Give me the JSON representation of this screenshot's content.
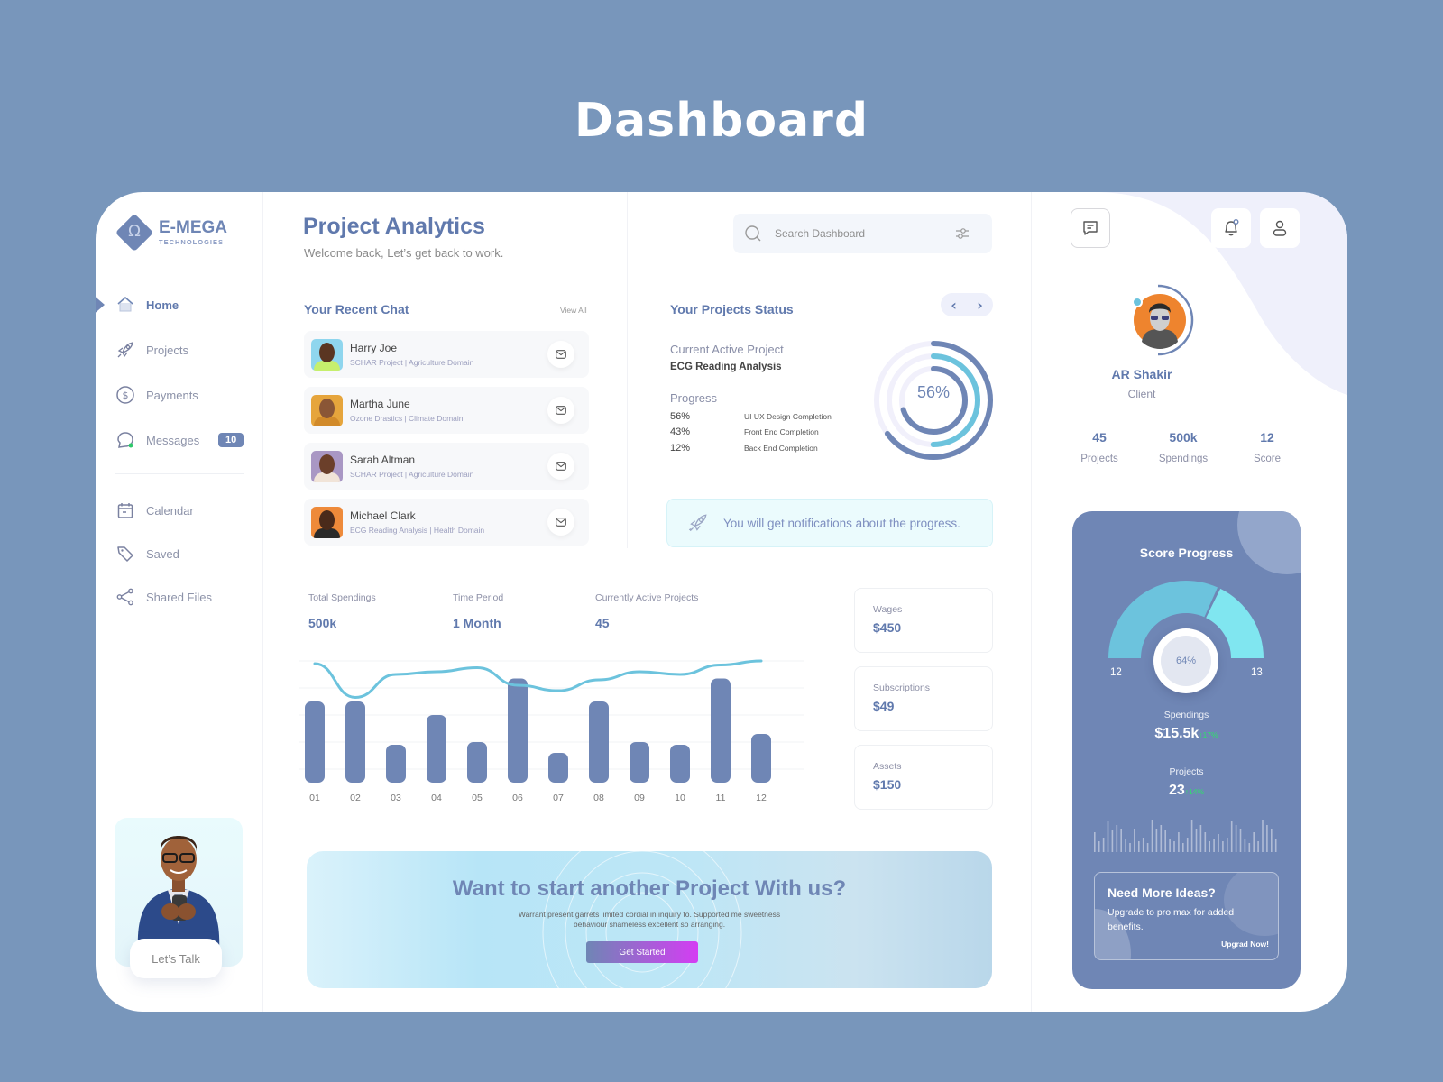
{
  "page": {
    "title": "Dashboard"
  },
  "brand": {
    "name": "E-MEGA",
    "tagline": "TECHNOLOGIES",
    "logo_icon": "omega-diamond-icon",
    "accent": "#6f86b5",
    "cyan": "#6cc3dd"
  },
  "sidebar": {
    "items": [
      {
        "label": "Home",
        "icon": "home-icon",
        "active": true
      },
      {
        "label": "Projects",
        "icon": "rocket-icon"
      },
      {
        "label": "Payments",
        "icon": "dollar-circle-icon"
      },
      {
        "label": "Messages",
        "icon": "chat-bubble-icon",
        "badge": "10"
      }
    ],
    "secondary_items": [
      {
        "label": "Calendar",
        "icon": "calendar-icon"
      },
      {
        "label": "Saved",
        "icon": "tag-icon"
      },
      {
        "label": "Shared Files",
        "icon": "share-icon"
      }
    ],
    "talk_button": "Let’s Talk"
  },
  "header": {
    "title": "Project Analytics",
    "subtitle": "Welcome back, Let’s get back to work.",
    "search_placeholder": "Search Dashboard"
  },
  "recent_chat": {
    "title": "Your Recent Chat",
    "view_all": "View All",
    "items": [
      {
        "name": "Harry Joe",
        "sub": "SCHAR Project | Agriculture Domain"
      },
      {
        "name": "Martha June",
        "sub": "Ozone Drastics | Climate Domain"
      },
      {
        "name": "Sarah Altman",
        "sub": "SCHAR Project | Agriculture Domain"
      },
      {
        "name": "Michael Clark",
        "sub": "ECG Reading Analysis | Health Domain"
      }
    ]
  },
  "project_status": {
    "title": "Your Projects Status",
    "current_label": "Current Active Project",
    "current_value": "ECG Reading Analysis",
    "progress_label": "Progress",
    "center_value": "56%",
    "rows": [
      {
        "pct": "56%",
        "value": 56,
        "label": "UI UX Design Completion"
      },
      {
        "pct": "43%",
        "value": 43,
        "label": "Front End Completion"
      },
      {
        "pct": "12%",
        "value": 12,
        "label": "Back End Completion"
      }
    ],
    "notification": "You will get notifications about the progress."
  },
  "stats": [
    {
      "label": "Total Spendings",
      "value": "500k"
    },
    {
      "label": "Time Period",
      "value": "1 Month"
    },
    {
      "label": "Currently Active Projects",
      "value": "45"
    }
  ],
  "chart_data": {
    "type": "bar",
    "categories": [
      "01",
      "02",
      "03",
      "04",
      "05",
      "06",
      "07",
      "08",
      "09",
      "10",
      "11",
      "12"
    ],
    "series": [
      {
        "name": "bars",
        "type": "bar",
        "values": [
          60,
          60,
          28,
          50,
          30,
          77,
          22,
          60,
          30,
          28,
          77,
          36
        ]
      },
      {
        "name": "trend",
        "type": "line",
        "values": [
          88,
          63,
          80,
          82,
          85,
          72,
          68,
          76,
          82,
          80,
          87,
          90
        ]
      }
    ],
    "ylim": [
      0,
      100
    ],
    "grid": true,
    "title": "",
    "xlabel": "",
    "ylabel": ""
  },
  "mini_cards": [
    {
      "label": "Wages",
      "value": "$450"
    },
    {
      "label": "Subscriptions",
      "value": "$49"
    },
    {
      "label": "Assets",
      "value": "$150"
    }
  ],
  "cta": {
    "title": "Want to start another Project With us?",
    "text": "Warrant present garrets limited cordial in inquiry to. Supported me sweetness behaviour shameless excellent so arranging.",
    "button": "Get Started"
  },
  "profile": {
    "name": "AR Shakir",
    "role": "Client",
    "stats": [
      {
        "value": "45",
        "label": "Projects"
      },
      {
        "value": "500k",
        "label": "Spendings"
      },
      {
        "value": "12",
        "label": "Score"
      }
    ]
  },
  "score": {
    "title": "Score Progress",
    "percent": "64%",
    "percent_value": 64,
    "left_label": "12",
    "right_label": "13",
    "spendings_label": "Spendings",
    "spendings_value": "$15.5k",
    "spendings_change": "↑17%",
    "projects_label": "Projects",
    "projects_value": "23",
    "projects_change": "↑14%",
    "ideas_title": "Need More Ideas?",
    "ideas_text": "Upgrade to pro max for added benefits.",
    "ideas_link": "Upgrad Now!"
  }
}
